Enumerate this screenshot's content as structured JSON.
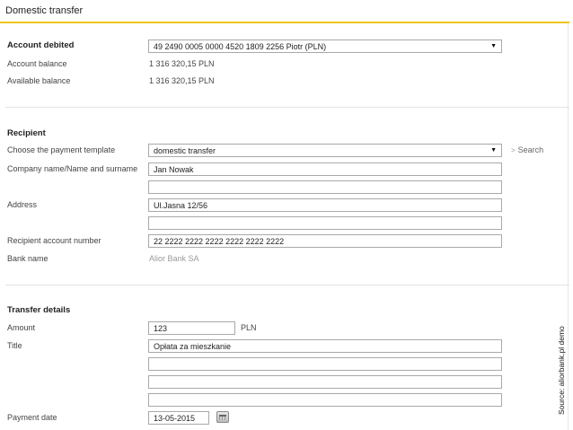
{
  "header": {
    "title": "Domestic transfer"
  },
  "account": {
    "section_title": "Account debited",
    "selected_account": "49 2490 0005 0000 4520 1809 2256 Piotr (PLN)",
    "balance_label": "Account balance",
    "balance_value": "1 316 320,15 PLN",
    "available_label": "Available balance",
    "available_value": "1 316 320,15 PLN"
  },
  "recipient": {
    "section_title": "Recipient",
    "template_label": "Choose the payment template",
    "template_value": "domestic transfer",
    "search_label": "Search",
    "name_label": "Company name/Name and surname",
    "name_line1": "Jan Nowak",
    "name_line2": "",
    "address_label": "Address",
    "address_line1": "Ul.Jasna 12/56",
    "address_line2": "",
    "account_label": "Recipient account number",
    "account_value": "22 2222 2222 2222 2222 2222 2222",
    "bank_label": "Bank name",
    "bank_value": "Alior Bank SA"
  },
  "transfer": {
    "section_title": "Transfer details",
    "amount_label": "Amount",
    "amount_value": "123",
    "currency": "PLN",
    "title_label": "Title",
    "title_line1": "Opłata za mieszkanie",
    "title_line2": "",
    "title_line3": "",
    "title_line4": "",
    "date_label": "Payment date",
    "date_value": "13-05-2015"
  },
  "source_note": "Source: aliorbank.pl demo",
  "colors": {
    "accent": "#f0c419",
    "border": "#a9a9a9"
  },
  "icons": {
    "dropdown": "triangle-down-icon",
    "search": "chevron-right-icon",
    "calendar": "calendar-icon"
  }
}
